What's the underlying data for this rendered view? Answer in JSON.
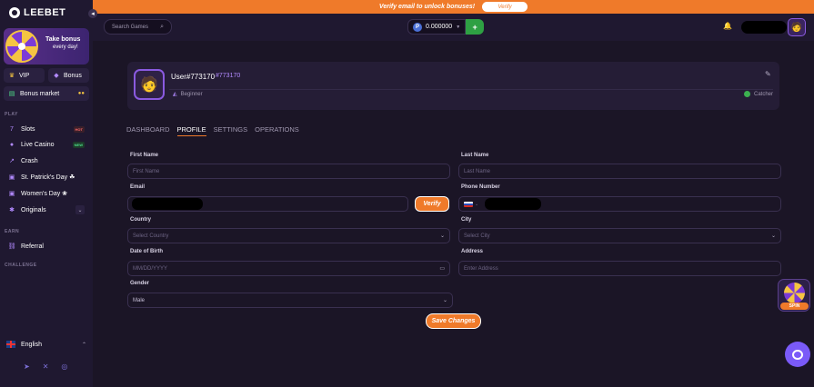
{
  "brand": {
    "name": "LEEBET"
  },
  "sidebar": {
    "bonus": {
      "title": "Take bonus",
      "subtitle": "every day!"
    },
    "vip_label": "VIP",
    "bonus_label": "Bonus",
    "bonus_market_label": "Bonus market",
    "sections": {
      "play": "PLAY",
      "earn": "EARN",
      "challenge": "CHALLENGE"
    },
    "play_items": [
      {
        "label": "Slots",
        "tag": "HOT"
      },
      {
        "label": "Live Casino",
        "tag": "NEW"
      },
      {
        "label": "Crash"
      },
      {
        "label": "St. Patrick's Day ☘"
      },
      {
        "label": "Women's Day ❀"
      },
      {
        "label": "Originals"
      }
    ],
    "referral_label": "Referral",
    "language": "English"
  },
  "banner": {
    "text": "Verify email to unlock bonuses!",
    "button": "Verify"
  },
  "header": {
    "search_placeholder": "Search Games",
    "balance": "0.000000",
    "currency_symbol": "P",
    "deposit_symbol": "+"
  },
  "profile": {
    "username": "User#773170",
    "user_id": "#773170",
    "rank": "Beginner",
    "next_rank": "Catcher"
  },
  "tabs": [
    "DASHBOARD",
    "PROFILE",
    "SETTINGS",
    "OPERATIONS"
  ],
  "form": {
    "first_name": {
      "label": "First Name",
      "placeholder": "First Name"
    },
    "last_name": {
      "label": "Last Name",
      "placeholder": "Last Name"
    },
    "email": {
      "label": "Email"
    },
    "verify_label": "Verify",
    "phone": {
      "label": "Phone Number"
    },
    "country": {
      "label": "Country",
      "placeholder": "Select Country"
    },
    "city": {
      "label": "City",
      "placeholder": "Select City"
    },
    "dob": {
      "label": "Date of Birth",
      "placeholder": "MM/DD/YYYY"
    },
    "address": {
      "label": "Address",
      "placeholder": "Enter Address"
    },
    "gender": {
      "label": "Gender",
      "value": "Male"
    },
    "save_label": "Save Changes"
  },
  "widgets": {
    "spin_label": "SPIN"
  },
  "colors": {
    "accent": "#ef7a2a",
    "purple": "#b28aff",
    "background": "#1b1526",
    "sidebar": "#1f1830",
    "chat": "#7a5af8"
  }
}
